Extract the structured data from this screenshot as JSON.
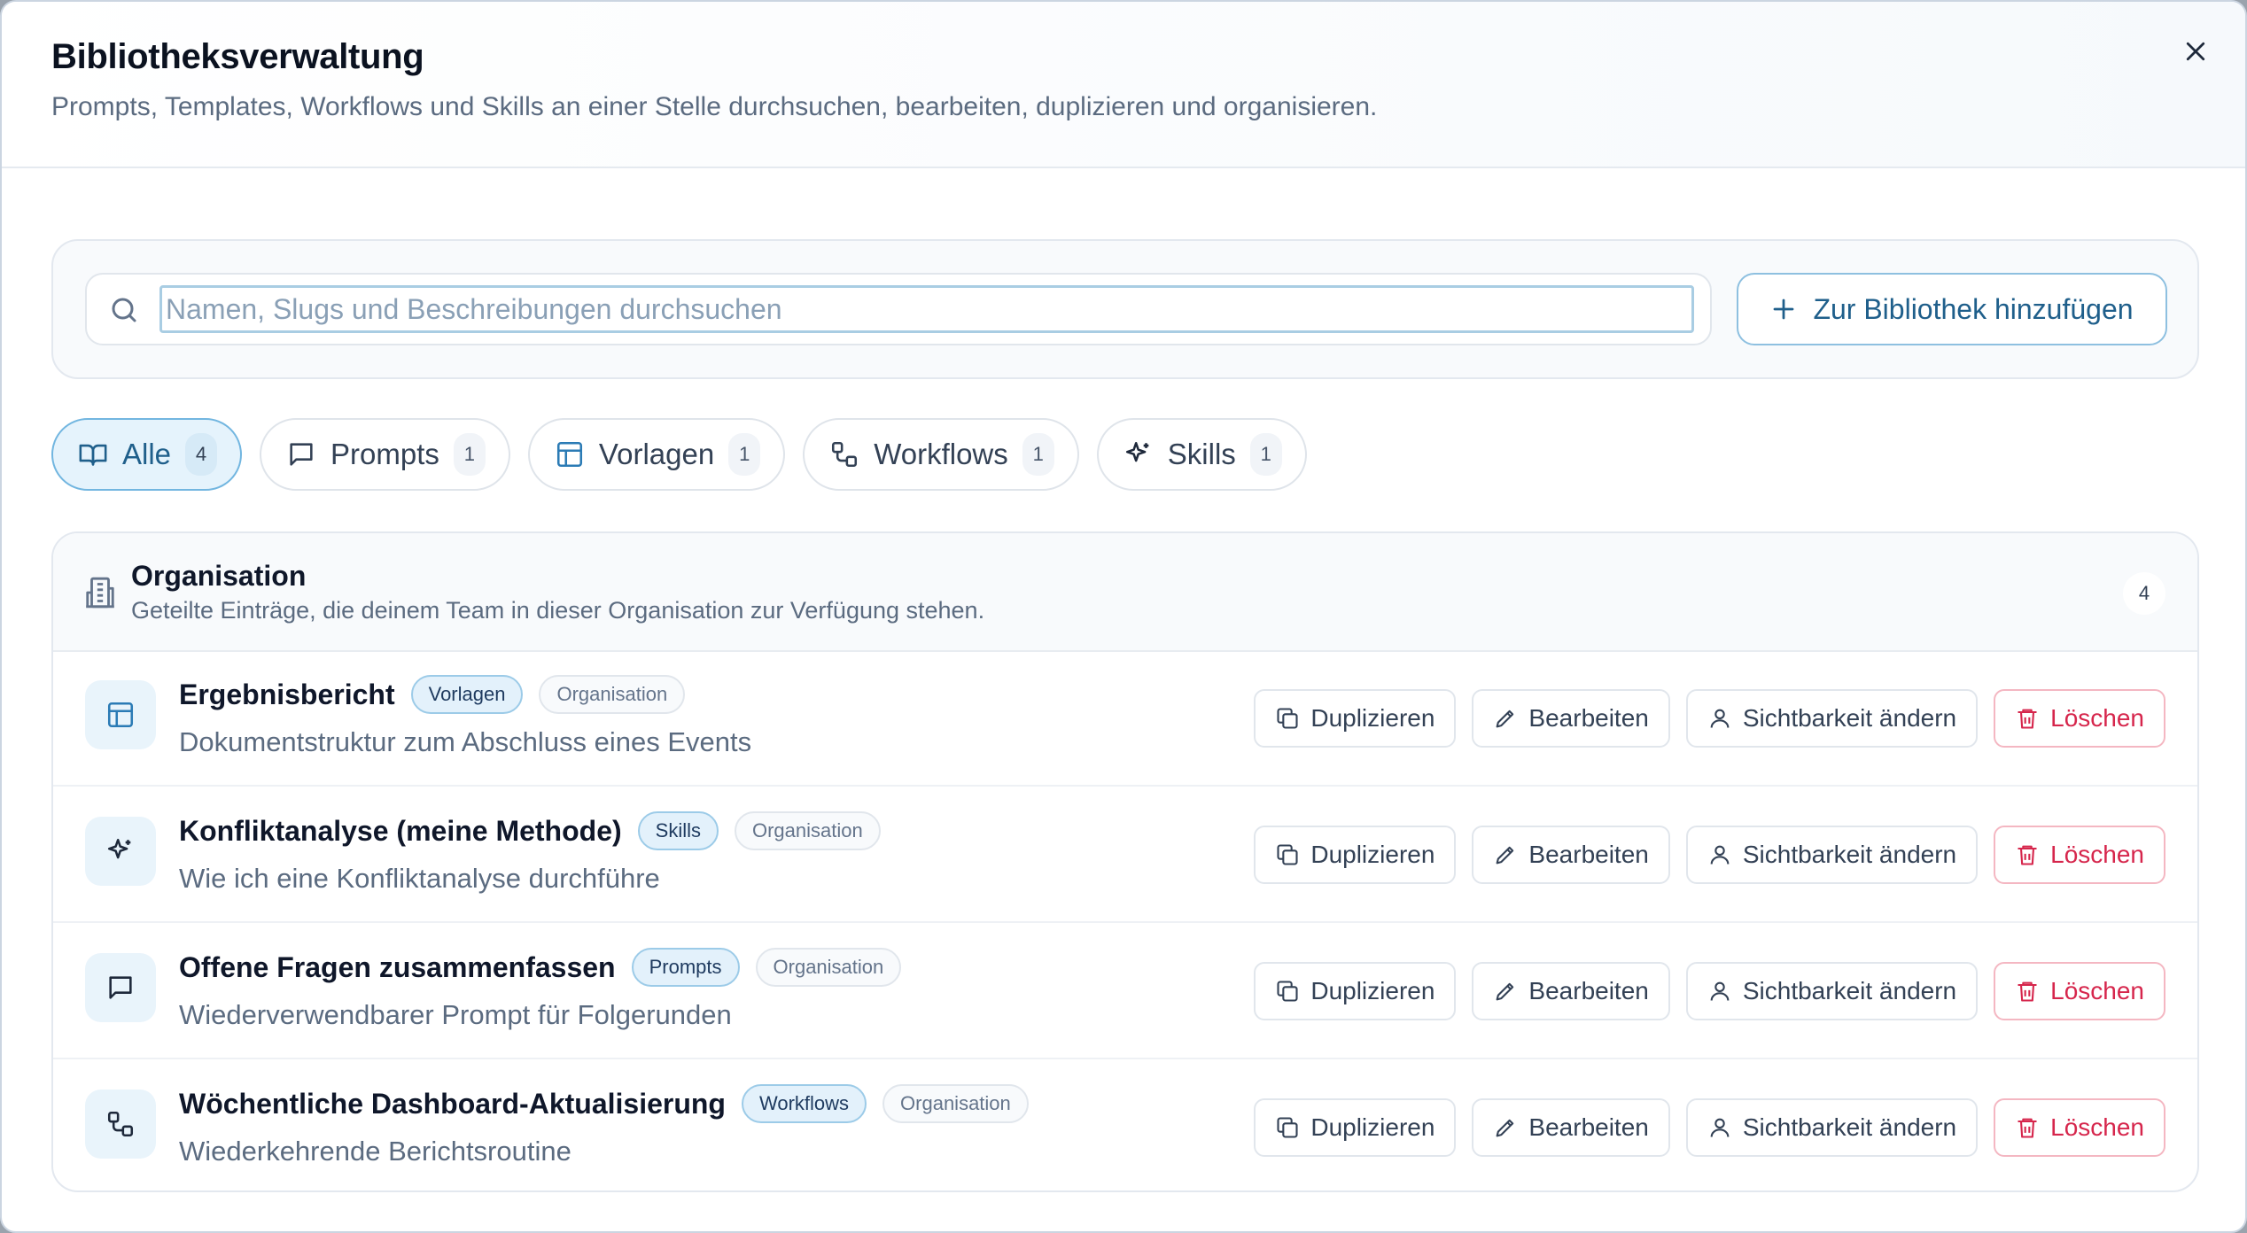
{
  "header": {
    "title": "Bibliotheksverwaltung",
    "subtitle": "Prompts, Templates, Workflows und Skills an einer Stelle durchsuchen, bearbeiten, duplizieren und organisieren."
  },
  "search": {
    "placeholder": "Namen, Slugs und Beschreibungen durchsuchen",
    "value": "",
    "add_label": "Zur Bibliothek hinzufügen"
  },
  "filters": [
    {
      "label": "Alle",
      "count": "4",
      "icon": "book-open-icon",
      "active": true
    },
    {
      "label": "Prompts",
      "count": "1",
      "icon": "message-square-icon",
      "active": false
    },
    {
      "label": "Vorlagen",
      "count": "1",
      "icon": "layout-template-icon",
      "active": false
    },
    {
      "label": "Workflows",
      "count": "1",
      "icon": "workflow-icon",
      "active": false
    },
    {
      "label": "Skills",
      "count": "1",
      "icon": "sparkles-icon",
      "active": false
    }
  ],
  "group": {
    "title": "Organisation",
    "description": "Geteilte Einträge, die deinem Team in dieser Organisation zur Verfügung stehen.",
    "count": "4",
    "icon": "building-icon"
  },
  "actions": {
    "duplicate": "Duplizieren",
    "edit": "Bearbeiten",
    "visibility": "Sichtbarkeit ändern",
    "delete": "Löschen"
  },
  "items": [
    {
      "title": "Ergebnisbericht",
      "type": "Vorlagen",
      "scope": "Organisation",
      "description": "Dokumentstruktur zum Abschluss eines Events",
      "icon": "layout-template-icon"
    },
    {
      "title": "Konfliktanalyse (meine Methode)",
      "type": "Skills",
      "scope": "Organisation",
      "description": "Wie ich eine Konfliktanalyse durchführe",
      "icon": "sparkles-icon"
    },
    {
      "title": "Offene Fragen zusammenfassen",
      "type": "Prompts",
      "scope": "Organisation",
      "description": "Wiederverwendbarer Prompt für Folgerunden",
      "icon": "message-square-icon"
    },
    {
      "title": "Wöchentliche Dashboard-Aktualisierung",
      "type": "Workflows",
      "scope": "Organisation",
      "description": "Wiederkehrende Berichtsroutine",
      "icon": "workflow-icon"
    }
  ],
  "colors": {
    "accent": "#1f5f8b",
    "accent_soft": "#e5f3fc",
    "danger": "#d6264c"
  }
}
